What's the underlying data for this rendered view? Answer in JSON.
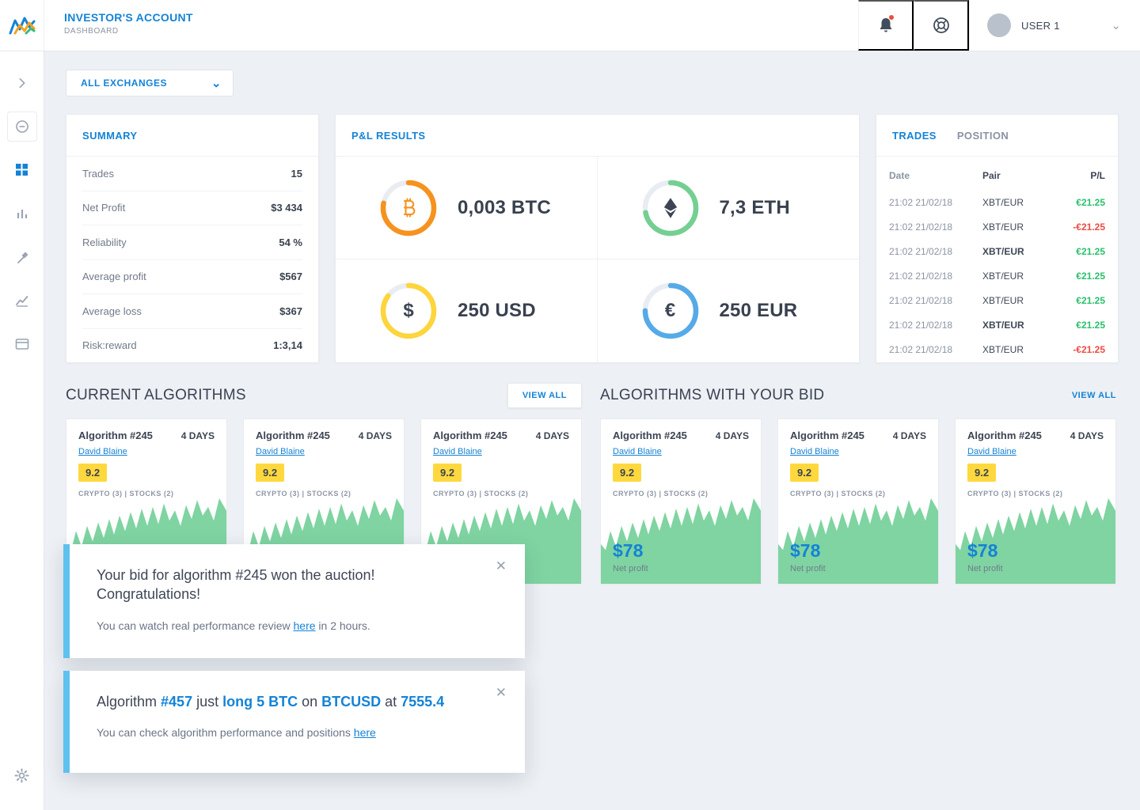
{
  "ui": {
    "close_glyph": "✕",
    "chevron_down_glyph": "⌄"
  },
  "header": {
    "title": "INVESTOR'S ACCOUNT",
    "subtitle": "DASHBOARD",
    "user_name": "USER 1"
  },
  "filters": {
    "exchanges_label": "ALL EXCHANGES"
  },
  "summary": {
    "title": "SUMMARY",
    "rows": [
      {
        "label": "Trades",
        "value": "15"
      },
      {
        "label": "Net Profit",
        "value": "$3 434"
      },
      {
        "label": "Reliability",
        "value": "54 %"
      },
      {
        "label": "Average profit",
        "value": "$567"
      },
      {
        "label": "Average loss",
        "value": "$367"
      },
      {
        "label": "Risk:reward",
        "value": "1:3,14"
      }
    ]
  },
  "pnl": {
    "title": "P&L RESULTS",
    "items": [
      {
        "name": "BTC",
        "value": "0,003 BTC",
        "ring_color": "#f6921e",
        "arc": 0.78
      },
      {
        "name": "ETH",
        "value": "7,3 ETH",
        "ring_color": "#74cf92",
        "arc": 0.72
      },
      {
        "name": "USD",
        "value": "250 USD",
        "symbol_glyph": "$",
        "ring_color": "#fdd53c",
        "arc": 0.85
      },
      {
        "name": "EUR",
        "value": "250 EUR",
        "symbol_glyph": "€",
        "ring_color": "#56aae8",
        "arc": 0.75
      }
    ]
  },
  "trades": {
    "tabs": [
      {
        "label": "TRADES",
        "active": true
      },
      {
        "label": "POSITION",
        "active": false
      }
    ],
    "columns": [
      "Date",
      "Pair",
      "P/L"
    ],
    "rows": [
      {
        "date": "21:02 21/02/18",
        "pair": "XBT/EUR",
        "pl": "€21.25",
        "negative": false,
        "bold": false
      },
      {
        "date": "21:02 21/02/18",
        "pair": "XBT/EUR",
        "pl": "-€21.25",
        "negative": true,
        "bold": false
      },
      {
        "date": "21:02 21/02/18",
        "pair": "XBT/EUR",
        "pl": "€21.25",
        "negative": false,
        "bold": true
      },
      {
        "date": "21:02 21/02/18",
        "pair": "XBT/EUR",
        "pl": "€21.25",
        "negative": false,
        "bold": false
      },
      {
        "date": "21:02 21/02/18",
        "pair": "XBT/EUR",
        "pl": "€21.25",
        "negative": false,
        "bold": false
      },
      {
        "date": "21:02 21/02/18",
        "pair": "XBT/EUR",
        "pl": "€21.25",
        "negative": false,
        "bold": true
      },
      {
        "date": "21:02 21/02/18",
        "pair": "XBT/EUR",
        "pl": "-€21.25",
        "negative": true,
        "bold": false
      }
    ]
  },
  "sections": {
    "current": {
      "title": "CURRENT ALGORITHMS",
      "view_all": "VIEW ALL"
    },
    "bids": {
      "title": "ALGORITHMS WITH YOUR BID",
      "view_all": "VIEW ALL"
    }
  },
  "current_algorithms": [
    {
      "name": "Algorithm #245",
      "duration": "4 DAYS",
      "author": "David Blaine",
      "rating": "9.2",
      "tags": "CRYPTO (3) | STOCKS (2)"
    },
    {
      "name": "Algorithm #245",
      "duration": "4 DAYS",
      "author": "David Blaine",
      "rating": "9.2",
      "tags": "CRYPTO (3) | STOCKS (2)"
    },
    {
      "name": "Algorithm #245",
      "duration": "4 DAYS",
      "author": "David Blaine",
      "rating": "9.2",
      "tags": "CRYPTO (3) | STOCKS (2)"
    }
  ],
  "bid_algorithms": [
    {
      "name": "Algorithm #245",
      "duration": "4 DAYS",
      "author": "David Blaine",
      "rating": "9.2",
      "tags": "CRYPTO (3) | STOCKS (2)",
      "profit": "$78",
      "profit_label": "Net profit"
    },
    {
      "name": "Algorithm #245",
      "duration": "4 DAYS",
      "author": "David Blaine",
      "rating": "9.2",
      "tags": "CRYPTO (3) | STOCKS (2)",
      "profit": "$78",
      "profit_label": "Net profit"
    },
    {
      "name": "Algorithm #245",
      "duration": "4 DAYS",
      "author": "David Blaine",
      "rating": "9.2",
      "tags": "CRYPTO (3) | STOCKS (2)",
      "profit": "$78",
      "profit_label": "Net profit"
    }
  ],
  "toasts": [
    {
      "title_line1": "Your bid for algorithm #245 won the auction!",
      "title_line2": "Congratulations!",
      "body_prefix": "You can watch real performance review ",
      "link_label": "here",
      "body_suffix": " in 2 hours."
    },
    {
      "message_parts": [
        {
          "text": "Algorithm ",
          "accent": false
        },
        {
          "text": "#457",
          "accent": true
        },
        {
          "text": " just ",
          "accent": false
        },
        {
          "text": "long 5 BTC",
          "accent": true
        },
        {
          "text": " on ",
          "accent": false
        },
        {
          "text": "BTCUSD",
          "accent": true
        },
        {
          "text": " at ",
          "accent": false
        },
        {
          "text": "7555.4",
          "accent": true
        }
      ],
      "body_prefix": "You can check algorithm performance and positions ",
      "link_label": "here"
    }
  ]
}
